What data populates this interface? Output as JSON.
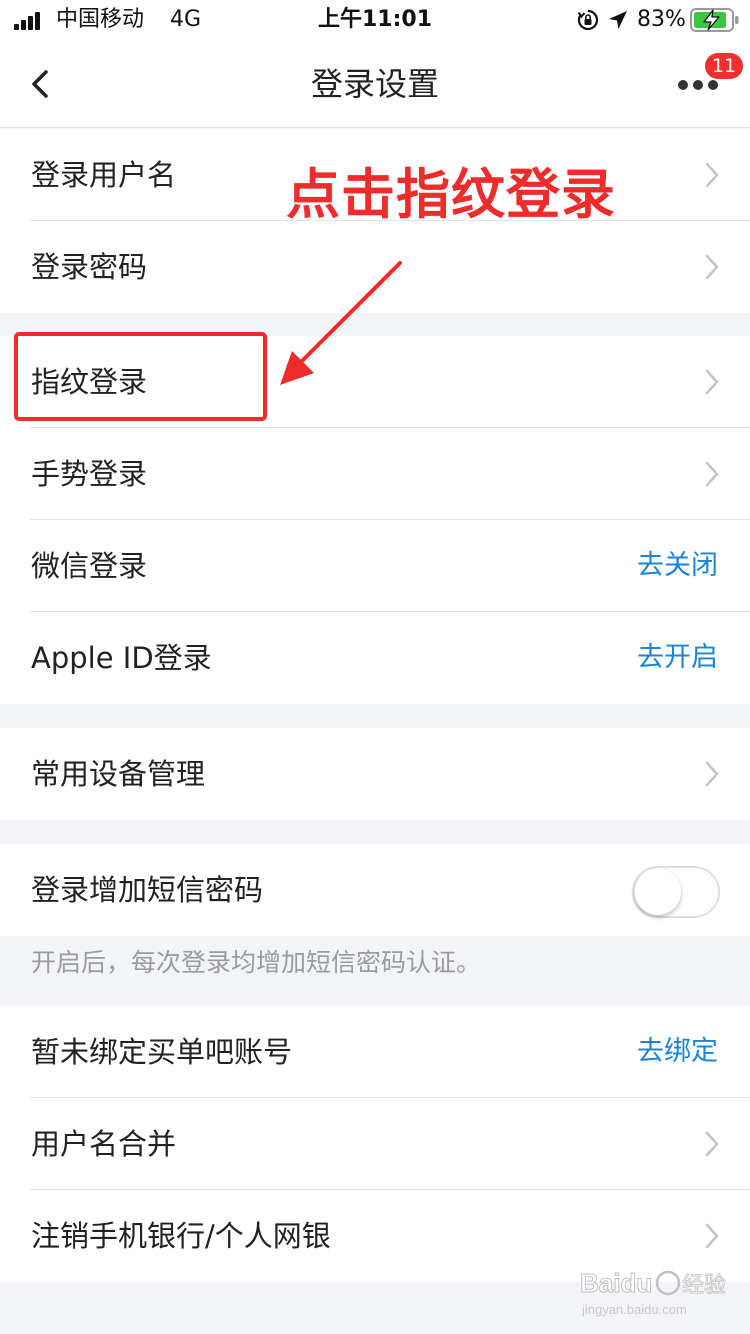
{
  "status_bar": {
    "carrier": "中国移动",
    "network": "4G",
    "time": "上午11:01",
    "battery_percent": "83%",
    "icons": [
      "signal-icon",
      "orientation-lock-icon",
      "location-arrow-icon",
      "battery-charging-icon"
    ]
  },
  "nav": {
    "title": "登录设置",
    "badge_count": "11",
    "icons": [
      "back-chevron-icon",
      "more-icon"
    ]
  },
  "sections": {
    "account": {
      "items": [
        {
          "label": "登录用户名"
        },
        {
          "label": "登录密码"
        }
      ]
    },
    "methods": {
      "items": [
        {
          "label": "指纹登录"
        },
        {
          "label": "手势登录"
        },
        {
          "label": "微信登录",
          "action": "去关闭"
        },
        {
          "label": "Apple ID登录",
          "action": "去开启"
        }
      ]
    },
    "devices": {
      "items": [
        {
          "label": "常用设备管理"
        }
      ]
    },
    "sms": {
      "label": "登录增加短信密码",
      "toggle_on": false,
      "hint": "开启后，每次登录均增加短信密码认证。"
    },
    "other": {
      "items": [
        {
          "label": "暂未绑定买单吧账号",
          "action": "去绑定"
        },
        {
          "label": "用户名合并"
        },
        {
          "label": "注销手机银行/个人网银"
        }
      ]
    }
  },
  "annotation": {
    "text": "点击指纹登录",
    "color": "#ef2b2b"
  },
  "watermark": {
    "brand": "Baidu 经验",
    "url": "jingyan.baidu.com"
  },
  "colors": {
    "link_blue": "#1a84d8",
    "badge_red": "#f22e2e",
    "background": "#f3f4f8",
    "battery_green": "#3cc83c"
  }
}
